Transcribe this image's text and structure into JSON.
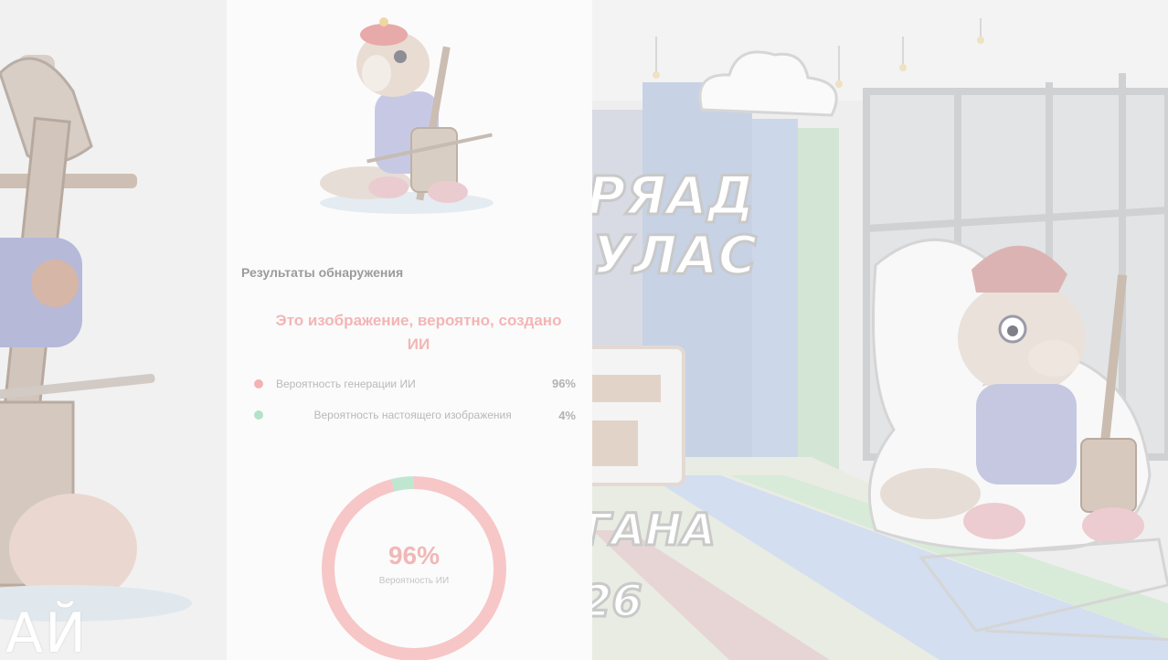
{
  "left": {
    "caption": "АЙ"
  },
  "detection": {
    "title": "Результаты обнаружения",
    "verdict": "Это изображение, вероятно, создано ИИ",
    "rows": [
      {
        "label": "Вероятность генерации ИИ",
        "value": "96%",
        "color": "#f4a9a9"
      },
      {
        "label": "Вероятность настоящего изображения",
        "value": "4%",
        "color": "#a9ddc4"
      }
    ],
    "donut": {
      "value": "96%",
      "caption": "Вероятность ИИ",
      "ai_fraction": 0.96,
      "ai_color": "#f7c6c6",
      "real_color": "#bfe6d1"
    }
  },
  "photo": {
    "sign_lines": [
      "РЯАД",
      "УЛАС",
      "ГАНА",
      "26"
    ]
  }
}
